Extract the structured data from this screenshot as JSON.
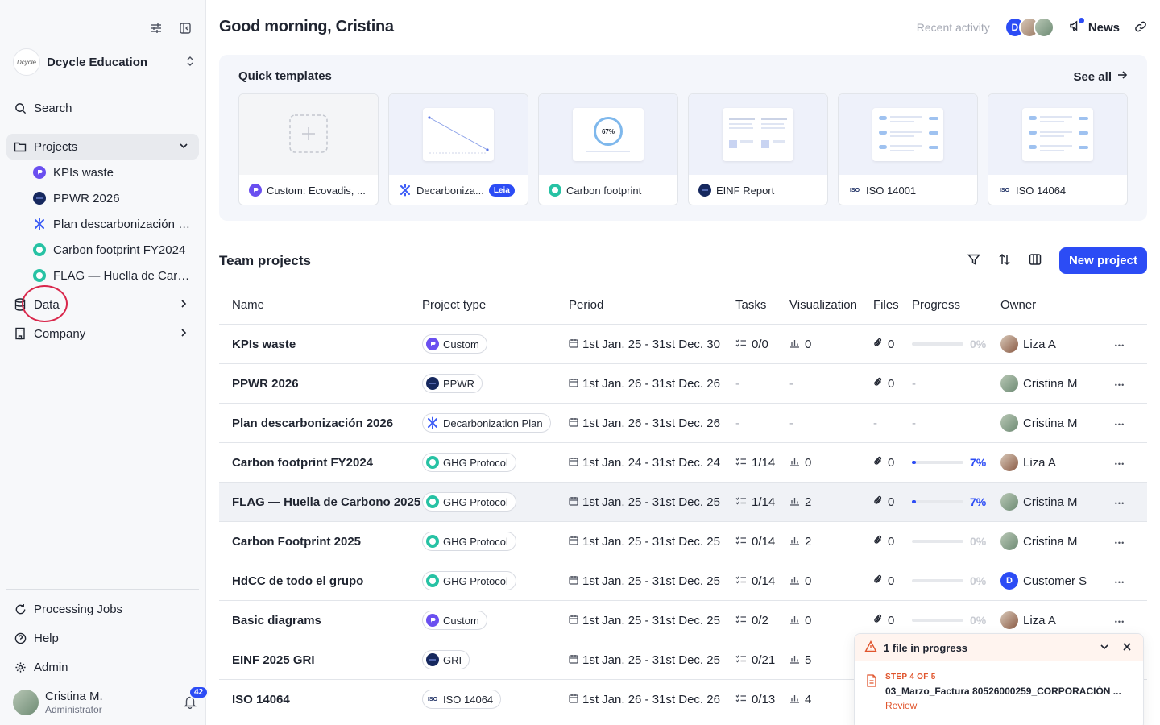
{
  "org": {
    "name": "Dcycle Education",
    "logo_text": "Dcycle"
  },
  "sidebar": {
    "search": "Search",
    "projects": "Projects",
    "project_items": [
      {
        "label": "KPIs waste",
        "icon": "custom-icon"
      },
      {
        "label": "PPWR 2026",
        "icon": "ppwr-icon"
      },
      {
        "label": "Plan descarbonización 2026",
        "icon": "decarbonization-icon"
      },
      {
        "label": "Carbon footprint FY2024",
        "icon": "ghg-icon"
      },
      {
        "label": "FLAG — Huella de Carbono 2025",
        "icon": "ghg-icon"
      }
    ],
    "data": "Data",
    "company": "Company",
    "processing_jobs": "Processing Jobs",
    "help": "Help",
    "admin": "Admin",
    "user_name": "Cristina M.",
    "user_role": "Administrator",
    "notifications": "42"
  },
  "header": {
    "greeting": "Good morning, Cristina",
    "recent_activity": "Recent activity",
    "news": "News"
  },
  "templates": {
    "title": "Quick templates",
    "see_all": "See all",
    "items": [
      {
        "label": "Custom: Ecovadis, ...",
        "badge": ""
      },
      {
        "label": "Decarboniza...",
        "badge": "Leia"
      },
      {
        "label": "Carbon footprint",
        "badge": "",
        "thumb_pct": "67%"
      },
      {
        "label": "EINF Report",
        "badge": ""
      },
      {
        "label": "ISO 14001",
        "badge": ""
      },
      {
        "label": "ISO 14064",
        "badge": ""
      }
    ]
  },
  "team_projects": {
    "title": "Team projects",
    "new_project": "New project",
    "columns": [
      "Name",
      "Project type",
      "Period",
      "Tasks",
      "Visualization",
      "Files",
      "Progress",
      "Owner"
    ],
    "rows": [
      {
        "name": "KPIs waste",
        "type": "Custom",
        "type_icon": "custom",
        "period": "1st Jan. 25 - 31st Dec. 30",
        "tasks": "0/0",
        "vis": "0",
        "files": "0",
        "progress": "0%",
        "progress_value": 0,
        "owner": "Liza A",
        "owner_icon": "liza"
      },
      {
        "name": "PPWR 2026",
        "type": "PPWR",
        "type_icon": "ppwr",
        "period": "1st Jan. 26 - 31st Dec. 26",
        "tasks": "-",
        "vis": "-",
        "files": "0",
        "progress": "-",
        "progress_value": null,
        "owner": "Cristina M",
        "owner_icon": "cristina"
      },
      {
        "name": "Plan descarbonización 2026",
        "type": "Decarbonization Plan",
        "type_icon": "decarb",
        "period": "1st Jan. 26 - 31st Dec. 26",
        "tasks": "-",
        "vis": "-",
        "files": "-",
        "progress": "-",
        "progress_value": null,
        "owner": "Cristina M",
        "owner_icon": "cristina"
      },
      {
        "name": "Carbon footprint FY2024",
        "type": "GHG Protocol",
        "type_icon": "ghg",
        "period": "1st Jan. 24 - 31st Dec. 24",
        "tasks": "1/14",
        "vis": "0",
        "files": "0",
        "progress": "7%",
        "progress_value": 7,
        "owner": "Liza A",
        "owner_icon": "liza"
      },
      {
        "name": "FLAG — Huella de Carbono 2025",
        "type": "GHG Protocol",
        "type_icon": "ghg",
        "period": "1st Jan. 25 - 31st Dec. 25",
        "tasks": "1/14",
        "vis": "2",
        "files": "0",
        "progress": "7%",
        "progress_value": 7,
        "owner": "Cristina M",
        "owner_icon": "cristina"
      },
      {
        "name": "Carbon Footprint 2025",
        "type": "GHG Protocol",
        "type_icon": "ghg",
        "period": "1st Jan. 25 - 31st Dec. 25",
        "tasks": "0/14",
        "vis": "2",
        "files": "0",
        "progress": "0%",
        "progress_value": 0,
        "owner": "Cristina M",
        "owner_icon": "cristina"
      },
      {
        "name": "HdCC de todo el grupo",
        "type": "GHG Protocol",
        "type_icon": "ghg",
        "period": "1st Jan. 25 - 31st Dec. 25",
        "tasks": "0/14",
        "vis": "0",
        "files": "0",
        "progress": "0%",
        "progress_value": 0,
        "owner": "Customer S",
        "owner_icon": "customer"
      },
      {
        "name": "Basic diagrams",
        "type": "Custom",
        "type_icon": "custom",
        "period": "1st Jan. 25 - 31st Dec. 25",
        "tasks": "0/2",
        "vis": "0",
        "files": "0",
        "progress": "0%",
        "progress_value": 0,
        "owner": "Liza A",
        "owner_icon": "liza"
      },
      {
        "name": "EINF 2025 GRI",
        "type": "GRI",
        "type_icon": "ppwr",
        "period": "1st Jan. 25 - 31st Dec. 25",
        "tasks": "0/21",
        "vis": "5",
        "files": "",
        "progress": "",
        "progress_value": null,
        "owner": "",
        "owner_icon": ""
      },
      {
        "name": "ISO 14064",
        "type": "ISO 14064",
        "type_icon": "iso",
        "period": "1st Jan. 26 - 31st Dec. 26",
        "tasks": "0/13",
        "vis": "4",
        "files": "",
        "progress": "",
        "progress_value": null,
        "owner": "",
        "owner_icon": ""
      }
    ]
  },
  "toast": {
    "title": "1 file in progress",
    "step": "STEP 4 OF 5",
    "filename": "03_Marzo_Factura 80526000259_CORPORACIÓN ...",
    "action": "Review"
  },
  "colors": {
    "accent": "#2c4cf5",
    "warning": "#e0552d",
    "annotation": "#d9274b"
  }
}
